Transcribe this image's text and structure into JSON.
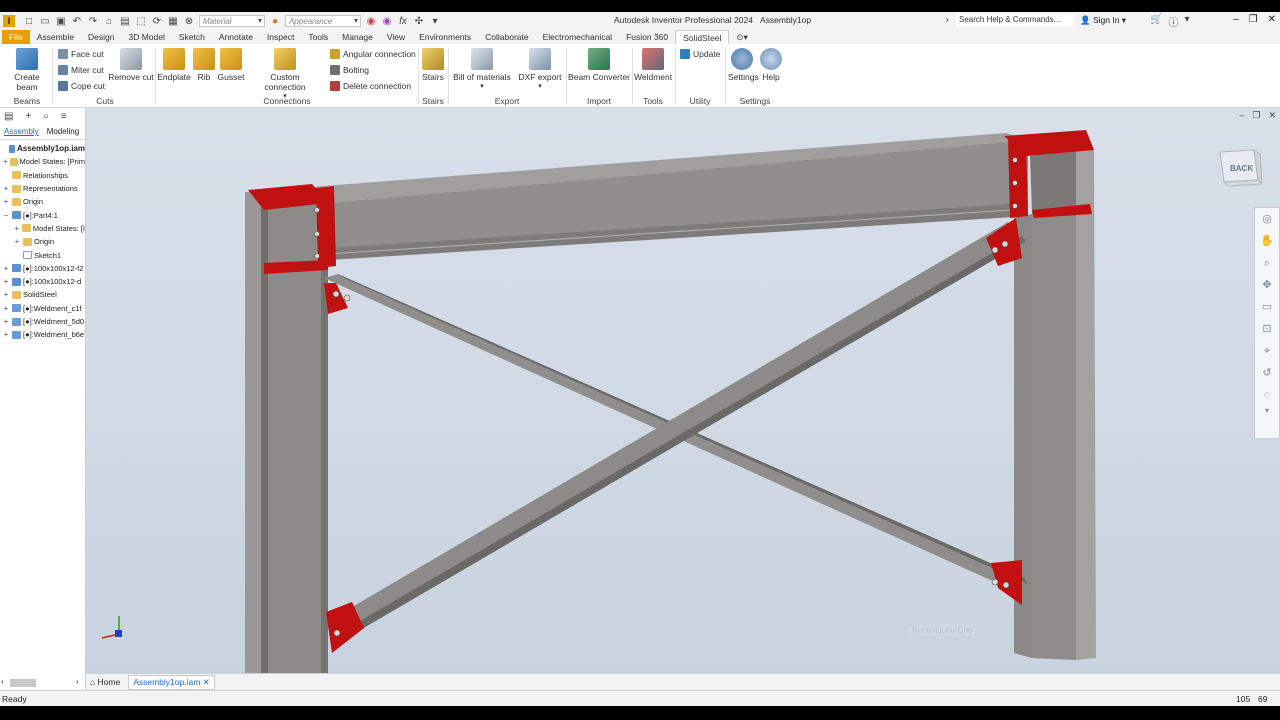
{
  "app": {
    "title": "Autodesk Inventor Professional 2024",
    "document": "Assembly1op"
  },
  "qat": {
    "material": "Material",
    "appearance": "Appearance",
    "fx": "fx"
  },
  "search": {
    "placeholder": "Search Help & Commands..."
  },
  "signin": "Sign In",
  "tabs": [
    {
      "label": "File"
    },
    {
      "label": "Assemble"
    },
    {
      "label": "Design"
    },
    {
      "label": "3D Model"
    },
    {
      "label": "Sketch"
    },
    {
      "label": "Annotate"
    },
    {
      "label": "Inspect"
    },
    {
      "label": "Tools"
    },
    {
      "label": "Manage"
    },
    {
      "label": "View"
    },
    {
      "label": "Environments"
    },
    {
      "label": "Collaborate"
    },
    {
      "label": "Electromechanical"
    },
    {
      "label": "Fusion 360"
    },
    {
      "label": "SolidSteel"
    }
  ],
  "ribbon": {
    "create_beam": "Create beam",
    "face_cut": "Face cut",
    "miter_cut": "Miter cut",
    "cope_cut": "Cope cut",
    "remove_cut": "Remove cut",
    "endplate": "Endplate",
    "rib": "Rib",
    "gusset": "Gusset",
    "custom_connection": "Custom connection",
    "angular_connection": "Angular connection",
    "bolting": "Bolting",
    "delete_connection": "Delete connection",
    "stairs": "Stairs",
    "bill_of_materials": "Bill of materials",
    "dxf_export": "DXF export",
    "beam_converter": "Beam Converter",
    "weldment": "Weldment",
    "update": "Update",
    "settings": "Settings",
    "help": "Help",
    "groups": {
      "beams": "Beams",
      "cuts": "Cuts",
      "connections": "Connections",
      "stairs": "Stairs",
      "export": "Export",
      "import": "Import",
      "tools": "Tools",
      "utility": "Utility",
      "settings": "Settings"
    }
  },
  "panel": {
    "tab_assembly": "Assembly",
    "tab_modeling": "Modeling"
  },
  "tree": [
    {
      "label": "Assembly1op.iam",
      "pm": "",
      "icon": "asm",
      "indent": 0,
      "bold": true
    },
    {
      "label": "Model States: [Prim",
      "pm": "+",
      "icon": "folder",
      "indent": 0
    },
    {
      "label": "Relationships",
      "pm": "",
      "icon": "folder",
      "indent": 0
    },
    {
      "label": "Representations",
      "pm": "+",
      "icon": "folder",
      "indent": 0
    },
    {
      "label": "Origin",
      "pm": "+",
      "icon": "folder",
      "indent": 0
    },
    {
      "label": "[●]:Part4:1",
      "pm": "−",
      "icon": "asm",
      "indent": 0
    },
    {
      "label": "Model States: [I",
      "pm": "+",
      "icon": "folder",
      "indent": 1
    },
    {
      "label": "Origin",
      "pm": "+",
      "icon": "folder",
      "indent": 1
    },
    {
      "label": "Sketch1",
      "pm": "",
      "icon": "sketch",
      "indent": 1
    },
    {
      "label": "[●]:100x100x12-f2",
      "pm": "+",
      "icon": "asm",
      "indent": 0
    },
    {
      "label": "[●]:100x100x12-d",
      "pm": "+",
      "icon": "asm",
      "indent": 0
    },
    {
      "label": "SolidSteel",
      "pm": "+",
      "icon": "folder",
      "indent": 0
    },
    {
      "label": "[●]:Weldment_c1f",
      "pm": "+",
      "icon": "weld",
      "indent": 0
    },
    {
      "label": "[●]:Weldment_5d0",
      "pm": "+",
      "icon": "weld",
      "indent": 0
    },
    {
      "label": "[●]:Weldment_b6e",
      "pm": "+",
      "icon": "weld",
      "indent": 0
    }
  ],
  "viewcube": {
    "face": "BACK"
  },
  "viewport": {
    "hint": "Rectangular Grip"
  },
  "doctabs": {
    "home": "Home",
    "document": "Assembly1op.iam"
  },
  "status": {
    "text": "Ready",
    "n1": "105",
    "n2": "69"
  },
  "colors": {
    "accent": "#e8a000",
    "steel": "#8c8b89",
    "plate": "#c01010",
    "active_link": "#1a6bd0"
  }
}
